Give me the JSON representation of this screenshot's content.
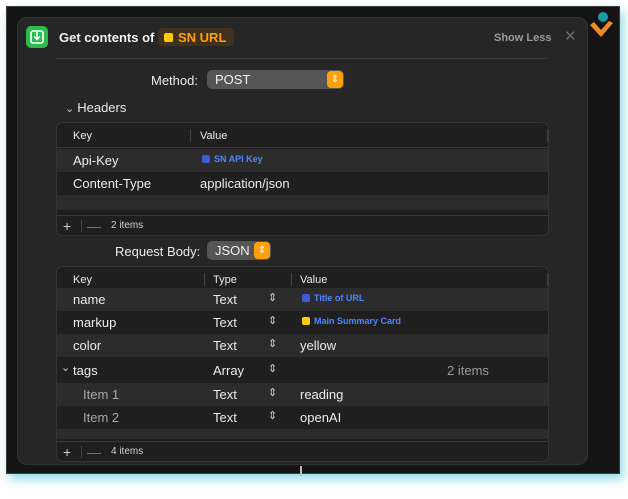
{
  "action": {
    "title": "Get contents of",
    "url_variable": "SN URL",
    "show_less_label": "Show Less",
    "close_label": "✕"
  },
  "method": {
    "label": "Method:",
    "value": "POST"
  },
  "headers": {
    "toggle_label": "Headers",
    "columns": {
      "key": "Key",
      "value": "Value"
    },
    "rows": [
      {
        "key": "Api-Key",
        "value": "SN API Key",
        "value_type": "variable"
      },
      {
        "key": "Content-Type",
        "value": "application/json",
        "value_type": "text"
      }
    ],
    "count_label": "2 items"
  },
  "request_body": {
    "label": "Request Body:",
    "value": "JSON",
    "columns": {
      "key": "Key",
      "type": "Type",
      "value": "Value"
    },
    "rows": [
      {
        "key": "name",
        "type": "Text",
        "value": "Title of URL",
        "value_type": "variable"
      },
      {
        "key": "markup",
        "type": "Text",
        "value": "Main Summary Card",
        "value_type": "variable"
      },
      {
        "key": "color",
        "type": "Text",
        "value": "yellow",
        "value_type": "text"
      },
      {
        "key": "tags",
        "type": "Array",
        "value": "2 items",
        "value_type": "count"
      },
      {
        "key": "Item 1",
        "type": "Text",
        "value": "reading",
        "value_type": "text"
      },
      {
        "key": "Item 2",
        "type": "Text",
        "value": "openAI",
        "value_type": "text"
      }
    ],
    "count_label": "4 items"
  },
  "controls": {
    "add": "+",
    "remove": "—",
    "stepper": "⇕",
    "chevron_down": "⌄"
  },
  "colors": {
    "accent_orange": "#ff9f0a",
    "variable_blue": "#4f86ff",
    "app_icon_green": "#2bbc4e"
  }
}
